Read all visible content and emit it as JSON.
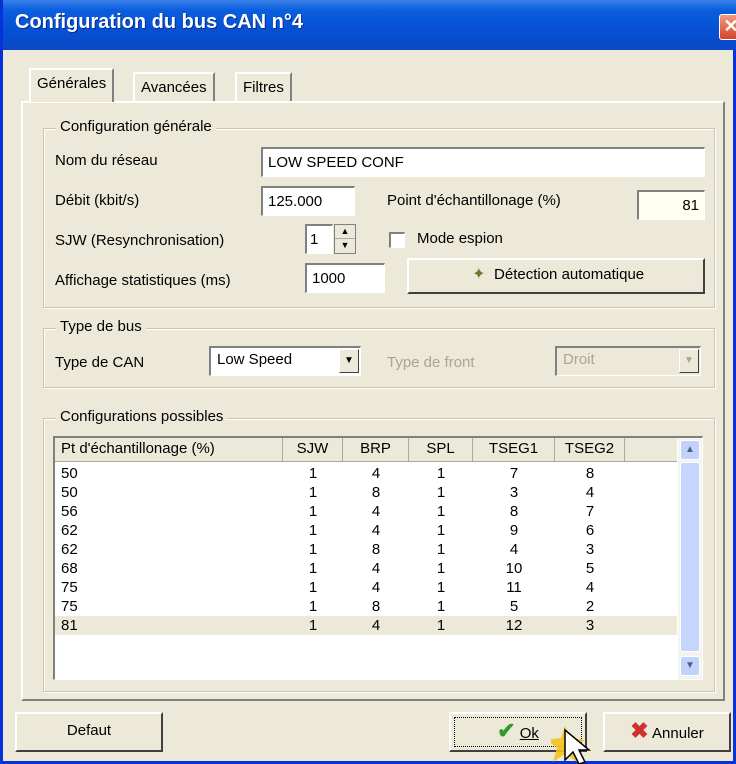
{
  "window": {
    "title": "Configuration du bus CAN n°4",
    "close_label": "✕"
  },
  "tabs": [
    {
      "label": "Générales",
      "active": true
    },
    {
      "label": "Avancées",
      "active": false
    },
    {
      "label": "Filtres",
      "active": false
    }
  ],
  "general": {
    "legend": "Configuration générale",
    "network_name_label": "Nom du réseau",
    "network_name_value": "LOW SPEED CONF",
    "bitrate_label": "Débit (kbit/s)",
    "bitrate_value": "125.000",
    "sample_point_label": "Point d'échantillonage (%)",
    "sample_point_value": "81",
    "sjw_label": "SJW (Resynchronisation)",
    "sjw_value": "1",
    "spy_mode_label": "Mode espion",
    "spy_mode_checked": false,
    "stats_label": "Affichage statistiques (ms)",
    "stats_value": "1000",
    "autodetect_label": "Détection automatique"
  },
  "bus_type": {
    "legend": "Type de bus",
    "can_type_label": "Type de CAN",
    "can_type_value": "Low Speed",
    "edge_type_label": "Type de front",
    "edge_type_value": "Droit"
  },
  "configs": {
    "legend": "Configurations possibles",
    "columns": [
      "Pt d'échantillonage (%)",
      "SJW",
      "BRP",
      "SPL",
      "TSEG1",
      "TSEG2"
    ],
    "rows": [
      [
        "50",
        "1",
        "4",
        "1",
        "7",
        "8"
      ],
      [
        "50",
        "1",
        "8",
        "1",
        "3",
        "4"
      ],
      [
        "56",
        "1",
        "4",
        "1",
        "8",
        "7"
      ],
      [
        "62",
        "1",
        "4",
        "1",
        "9",
        "6"
      ],
      [
        "62",
        "1",
        "8",
        "1",
        "4",
        "3"
      ],
      [
        "68",
        "1",
        "4",
        "1",
        "10",
        "5"
      ],
      [
        "75",
        "1",
        "4",
        "1",
        "11",
        "4"
      ],
      [
        "75",
        "1",
        "8",
        "1",
        "5",
        "2"
      ],
      [
        "81",
        "1",
        "4",
        "1",
        "12",
        "3"
      ]
    ],
    "selected_row": 8
  },
  "buttons": {
    "default_label": "Defaut",
    "ok_label": "Ok",
    "cancel_label": "Annuler"
  },
  "colors": {
    "titlebar": "#0a5fde",
    "face": "#ece9d8",
    "ok_check": "#2f9a2f",
    "cancel_x": "#d03030"
  }
}
